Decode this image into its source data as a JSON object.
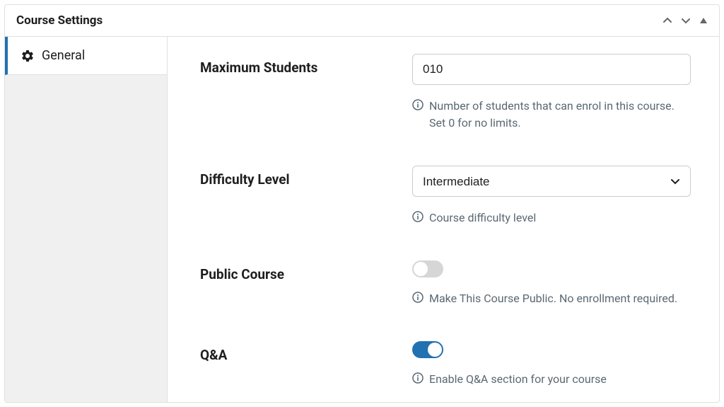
{
  "panel": {
    "title": "Course Settings"
  },
  "sidebar": {
    "items": [
      {
        "label": "General"
      }
    ]
  },
  "fields": {
    "max_students": {
      "label": "Maximum Students",
      "value": "010",
      "hint": "Number of students that can enrol in this course. Set 0 for no limits."
    },
    "difficulty": {
      "label": "Difficulty Level",
      "value": "Intermediate",
      "hint": "Course difficulty level"
    },
    "public_course": {
      "label": "Public Course",
      "enabled": false,
      "hint": "Make This Course Public. No enrollment required."
    },
    "qa": {
      "label": "Q&A",
      "enabled": true,
      "hint": "Enable Q&A section for your course"
    }
  }
}
